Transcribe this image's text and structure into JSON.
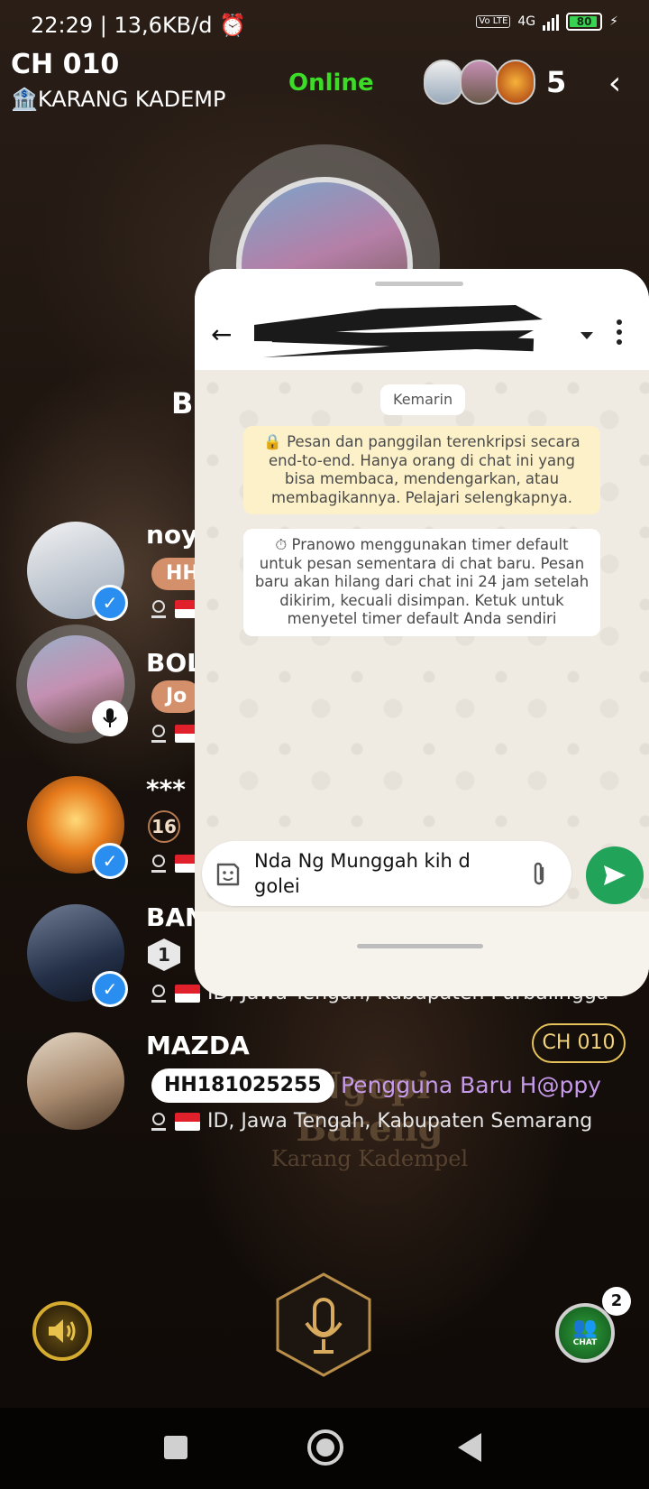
{
  "status_bar": {
    "time_speed": "22:29 | 13,6KB/d",
    "volte": "Vo LTE",
    "network": "4G",
    "battery": "80",
    "battery_level": 0.8
  },
  "header": {
    "room_code": "CH 010",
    "room_name": "KARANG KADEMP",
    "room_icon": "bank-icon",
    "status": "Online",
    "audience_count": "5",
    "back_icon": "chevron-left-icon"
  },
  "host": {
    "partial_name": "BO"
  },
  "users": [
    {
      "name": "noy",
      "tag": "HH",
      "tag_color": "#d4906a"
    },
    {
      "name": "BOL",
      "tag": "Jo",
      "tag_color": "#d4906a"
    },
    {
      "name": "***",
      "level": "16"
    },
    {
      "name": "BAN",
      "level": "1",
      "location": "ID, Jawa Tengah, Kabupaten Purbalingga"
    },
    {
      "name": "MAZDA",
      "channel": "CH 010",
      "code": "HH181025255",
      "label": "Pengguna Baru H@ppy",
      "location": "ID, Jawa Tengah, Kabupaten Semarang"
    }
  ],
  "watermark": {
    "line1": "Ngopi Bareng",
    "line2": "Karang Kadempel"
  },
  "controls": {
    "speaker_icon": "speaker-icon",
    "mic_icon": "microphone-icon",
    "chat_label": "CHAT",
    "chat_badge": "2"
  },
  "whatsapp": {
    "date_chip": "Kemarin",
    "encryption_notice": "🔒 Pesan dan panggilan terenkripsi secara end-to-end. Hanya orang di chat ini yang bisa membaca, mendengarkan, atau membagikannya. Pelajari selengkapnya.",
    "timer_notice": "⏱ Pranowo menggunakan timer default untuk pesan sementara di chat baru. Pesan baru akan hilang dari chat ini 24 jam setelah dikirim, kecuali disimpan. Ketuk untuk menyetel timer default Anda sendiri",
    "input_text": "Nda Ng Munggah kih d golei",
    "colors": {
      "accent": "#21a35a",
      "encryption_bg": "#fdf1c9"
    }
  }
}
